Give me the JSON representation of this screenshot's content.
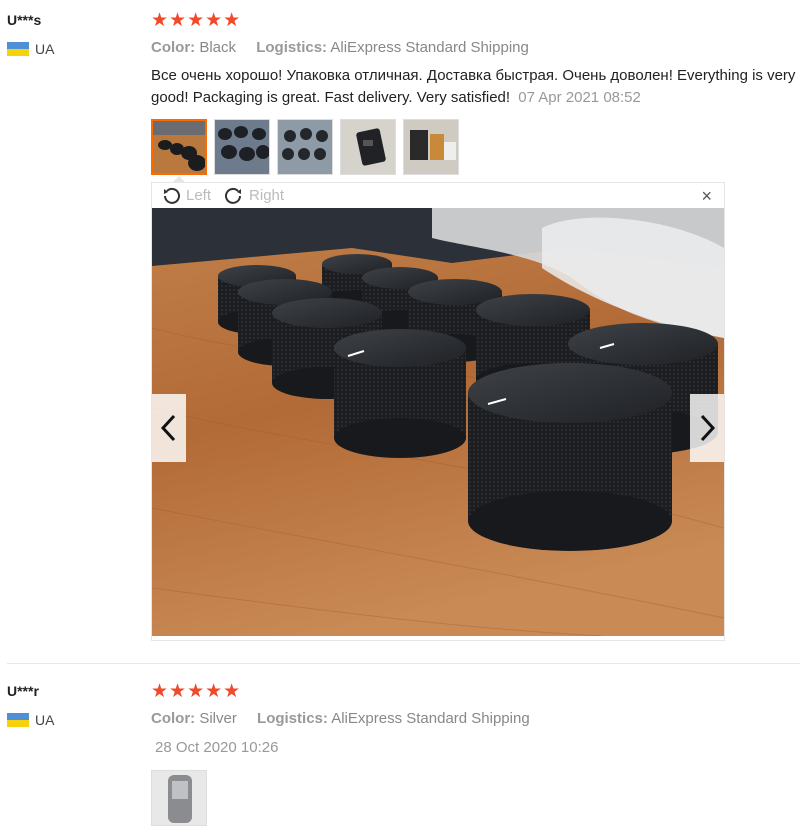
{
  "reviews": [
    {
      "user": "U***s",
      "country": "UA",
      "stars": "★★★★★",
      "color_label": "Color:",
      "color_value": "Black",
      "logistics_label": "Logistics:",
      "logistics_value": "AliExpress Standard Shipping",
      "text": "Все очень хорошо! Упаковка отличная. Доставка быстрая. Очень доволен! Everything is very good! Packaging is great. Fast delivery. Very satisfied!",
      "date": "07 Apr 2021 08:52"
    },
    {
      "user": "U***r",
      "country": "UA",
      "stars": "★★★★★",
      "color_label": "Color:",
      "color_value": "Silver",
      "logistics_label": "Logistics:",
      "logistics_value": "AliExpress Standard Shipping",
      "date": "28 Oct 2020 10:26"
    }
  ],
  "viewer": {
    "rotate_left": "Left",
    "rotate_right": "Right",
    "close": "×"
  },
  "colors": {
    "star": "#f0492b",
    "active_thumb_border": "#ff6a00"
  }
}
